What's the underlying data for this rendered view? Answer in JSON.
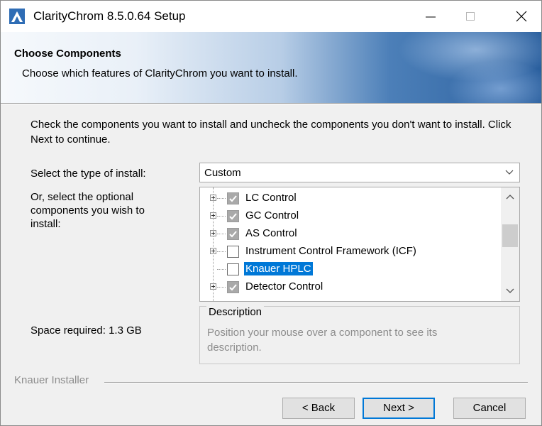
{
  "window": {
    "title": "ClarityChrom 8.5.0.64 Setup",
    "controls": [
      "minimize",
      "maximize",
      "close"
    ]
  },
  "header": {
    "title": "Choose Components",
    "subtitle": "Choose which features of ClarityChrom you want to install."
  },
  "body": {
    "instructions": "Check the components you want to install and uncheck the components you don't want to install. Click Next to continue.",
    "install_type_label": "Select the type of install:",
    "install_type_value": "Custom",
    "optional_label": "Or, select the optional components you wish to install:",
    "components": [
      {
        "label": "LC Control",
        "checked": true,
        "expandable": true,
        "selected": false
      },
      {
        "label": "GC Control",
        "checked": true,
        "expandable": true,
        "selected": false
      },
      {
        "label": "AS Control",
        "checked": true,
        "expandable": true,
        "selected": false
      },
      {
        "label": "Instrument Control Framework (ICF)",
        "checked": false,
        "expandable": true,
        "selected": false
      },
      {
        "label": "Knauer HPLC",
        "checked": false,
        "expandable": false,
        "selected": true
      },
      {
        "label": "Detector Control",
        "checked": true,
        "expandable": true,
        "selected": false
      }
    ],
    "space_required": "Space required: 1.3 GB",
    "description_title": "Description",
    "description_text": "Position your mouse over a component to see its description."
  },
  "footer": {
    "branding": "Knauer Installer",
    "back_label": "< Back",
    "next_label": "Next >",
    "cancel_label": "Cancel"
  },
  "colors": {
    "selection": "#0078d7",
    "default_button_border": "#0078d7"
  }
}
